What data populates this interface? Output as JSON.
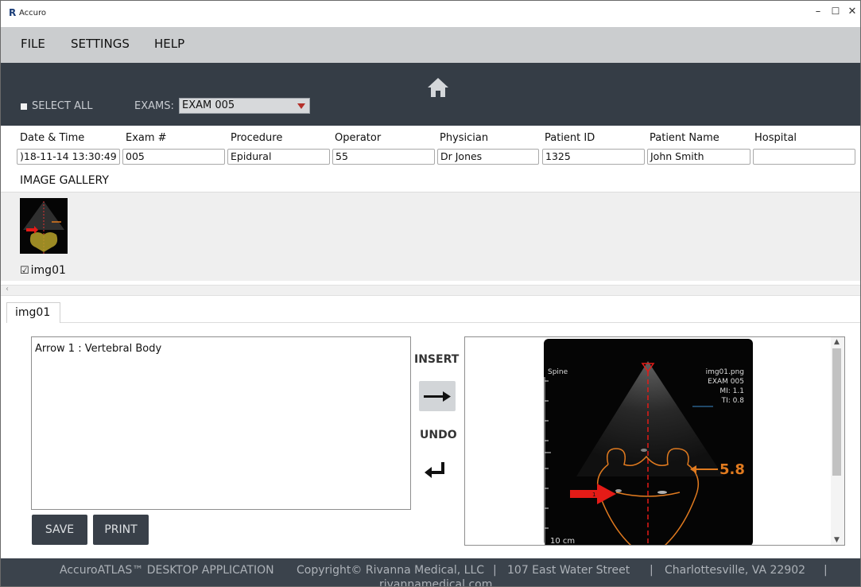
{
  "window": {
    "logo": "R",
    "title": "Accuro",
    "controls": [
      "–",
      "☐",
      "✕"
    ]
  },
  "menu": [
    "FILE",
    "SETTINGS",
    "HELP"
  ],
  "header": {
    "select_all": "SELECT ALL",
    "exams_label": "EXAMS:",
    "exams_value": "EXAM 005"
  },
  "fields": [
    {
      "label": "Date & Time",
      "value": ")18-11-14 13:30:49"
    },
    {
      "label": "Exam #",
      "value": "005"
    },
    {
      "label": "Procedure",
      "value": "Epidural"
    },
    {
      "label": "Operator",
      "value": "55"
    },
    {
      "label": "Physician",
      "value": "Dr Jones"
    },
    {
      "label": "Patient ID",
      "value": "1325"
    },
    {
      "label": "Patient Name",
      "value": "John Smith"
    },
    {
      "label": "Hospital",
      "value": ""
    }
  ],
  "gallery": {
    "title": "IMAGE GALLERY",
    "checkbox": "☑",
    "image_label": "img01"
  },
  "tab": {
    "label": "img01"
  },
  "notes": {
    "text": "Arrow 1 : Vertebral Body"
  },
  "actions": {
    "insert_label": "INSERT",
    "undo_label": "UNDO",
    "save": "SAVE",
    "print": "PRINT"
  },
  "ultrasound": {
    "mode": "Spine",
    "filename": "img01.png",
    "exam": "EXAM 005",
    "mi": "MI: 1.1",
    "ti": "TI: 0.8",
    "measurement": "5.8",
    "depth": "10 cm",
    "arrow_number": "1",
    "accent": "#e07a1f",
    "arrow_color": "#e41b17"
  },
  "footer": {
    "app": "AccuroATLAS™ DESKTOP APPLICATION",
    "copyright": "Copyright© Rivanna Medical, LLC",
    "sep1": "|",
    "address": "107 East Water Street",
    "sep2": "|",
    "city": "Charlottesville, VA 22902",
    "sep3": "|",
    "website": "rivannamedical.com"
  }
}
